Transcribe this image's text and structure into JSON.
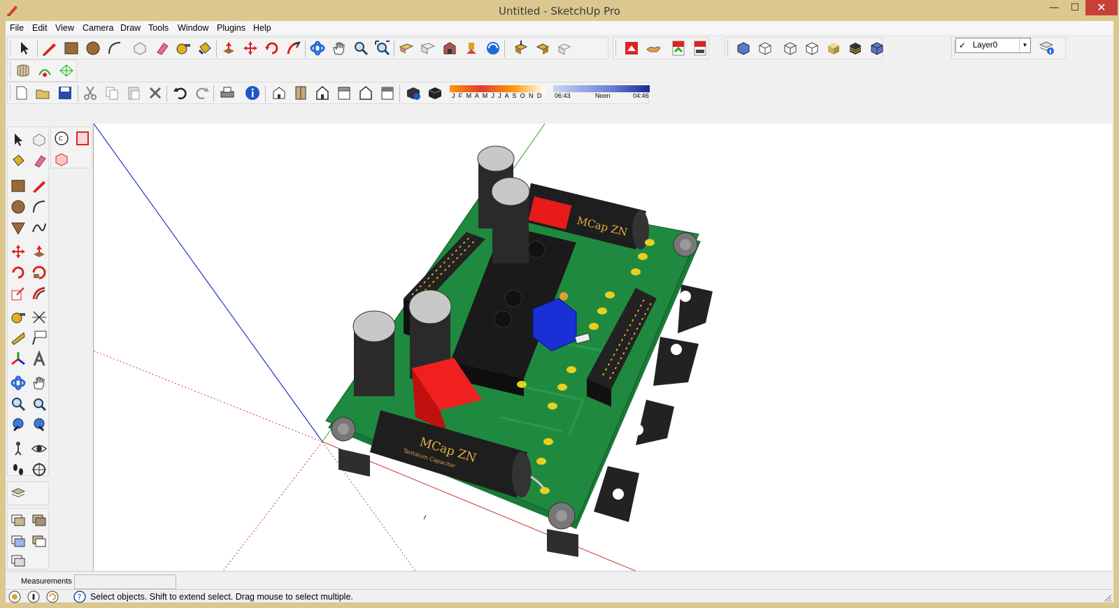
{
  "window": {
    "title": "Untitled - SketchUp Pro",
    "minimize": "—",
    "maximize": "☐",
    "close": "✕"
  },
  "menu": [
    "File",
    "Edit",
    "View",
    "Camera",
    "Draw",
    "Tools",
    "Window",
    "Plugins",
    "Help"
  ],
  "layers": {
    "current": "Layer0",
    "checked": "✓"
  },
  "shadows": {
    "months": "J F M A M J J A S O N D",
    "time_start": "06:43",
    "time_mid": "Noon",
    "time_end": "04:46"
  },
  "measurements": {
    "label": "Measurements",
    "value": ""
  },
  "status": {
    "text": "Select objects. Shift to extend select. Drag mouse to select multiple."
  },
  "model": {
    "capacitor_label": "MCap ZN",
    "capacitor_sub": "Tantalum Capacitor"
  },
  "colors": {
    "accent_frame": "#dcc78f",
    "pcb_green": "#1f8a3f",
    "component_red": "#e81a1a",
    "trimmer_blue": "#1a2fd6",
    "close_red": "#c7403a"
  }
}
